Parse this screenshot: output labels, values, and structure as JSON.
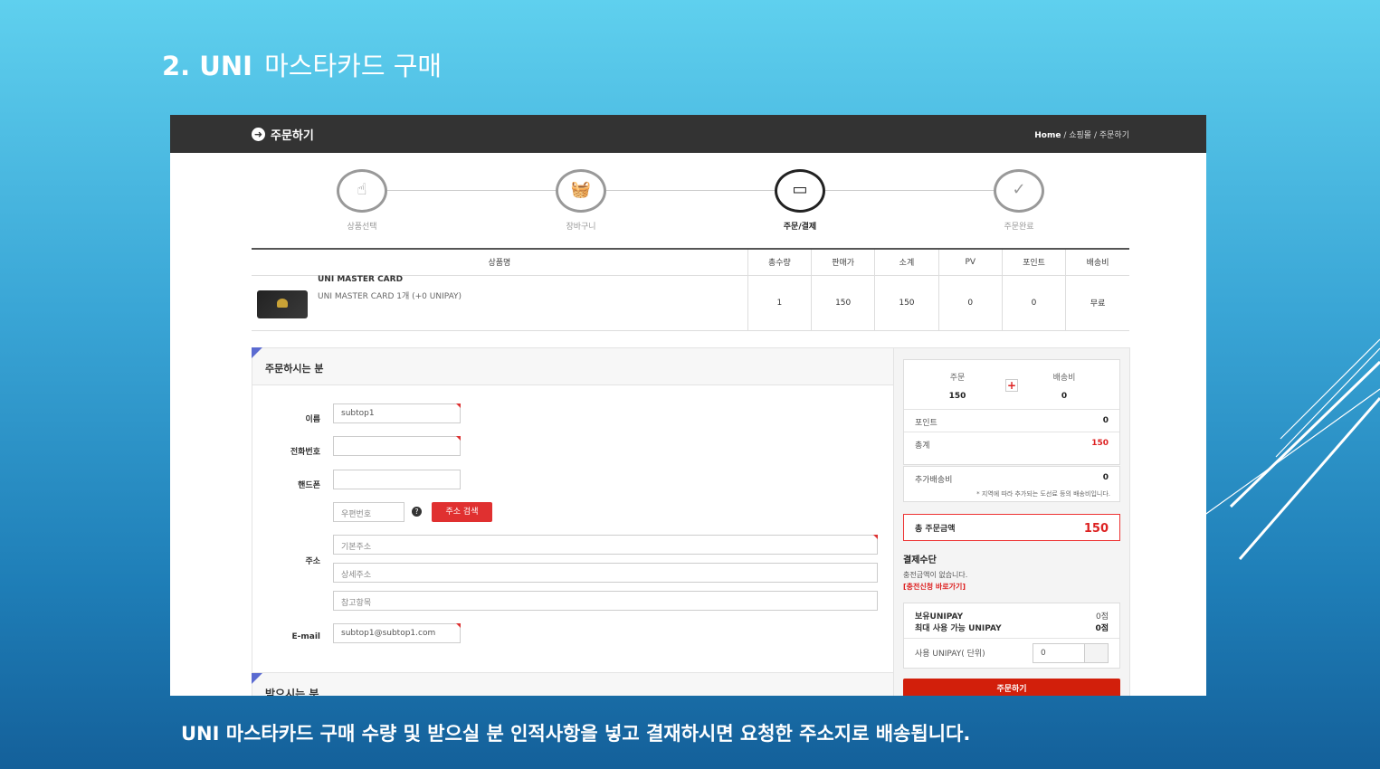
{
  "slide": {
    "title_num": "2. UNI",
    "title_rest": "마스타카드 구매",
    "caption": "UNI 마스타카드 구매 수량 및 받으실 분 인적사항을 넣고 결재하시면 요청한 주소지로 배송됩니다."
  },
  "page": {
    "title": "주문하기",
    "breadcrumb": {
      "home": "Home",
      "sep": "/",
      "mall": "쇼핑몰",
      "current": "주문하기"
    }
  },
  "steps": [
    {
      "label": "상품선택",
      "icon": "hand-pointer-icon"
    },
    {
      "label": "장바구니",
      "icon": "basket-icon"
    },
    {
      "label": "주문/결제",
      "icon": "credit-card-icon",
      "active": true
    },
    {
      "label": "주문완료",
      "icon": "checkmark-icon"
    }
  ],
  "product_table": {
    "headers": [
      "상품명",
      "총수량",
      "판매가",
      "소계",
      "PV",
      "포인트",
      "배송비"
    ],
    "rows": [
      {
        "name": "UNI MASTER CARD",
        "desc": "UNI MASTER CARD 1개 (+0 UNIPAY)",
        "qty": "1",
        "price": "150",
        "subtotal": "150",
        "pv": "0",
        "point": "0",
        "shipping": "무료"
      }
    ]
  },
  "orderer": {
    "heading": "주문하시는 분",
    "name_label": "이름",
    "name_value": "subtop1",
    "phone_label": "전화번호",
    "phone_value": "",
    "mobile_label": "핸드폰",
    "mobile_value": "",
    "zip_placeholder": "우편번호",
    "zip_help": "?",
    "address_search": "주소 검색",
    "address_label": "주소",
    "addr1_placeholder": "기본주소",
    "addr2_placeholder": "상세주소",
    "addr3_placeholder": "참고항목",
    "email_label": "E-mail",
    "email_value": "subtop1@subtop1.com"
  },
  "receiver": {
    "heading": "받으시는 분"
  },
  "summary": {
    "order_label": "주문",
    "order_value": "150",
    "shipping_label": "배송비",
    "shipping_value": "0",
    "plus": "+",
    "point_label": "포인트",
    "point_value": "0",
    "subtotal_label": "총계",
    "subtotal_value": "150",
    "extra_label": "추가배송비",
    "extra_value": "0",
    "extra_note": "* 지역에 따라 추가되는 도선료 등의 배송비입니다.",
    "total_label": "총 주문금액",
    "total_value": "150",
    "pay_title": "결제수단",
    "pay_msg": "충전금액이 없습니다.",
    "pay_link": "[충전신청 바로가기]",
    "own_label": "보유UNIPAY",
    "own_value": "0점",
    "max_label": "최대 사용 가능 UNIPAY",
    "max_value": "0점",
    "use_label": "사용 UNIPAY( 단위)",
    "use_value": "0",
    "order_button": "주문하기"
  }
}
